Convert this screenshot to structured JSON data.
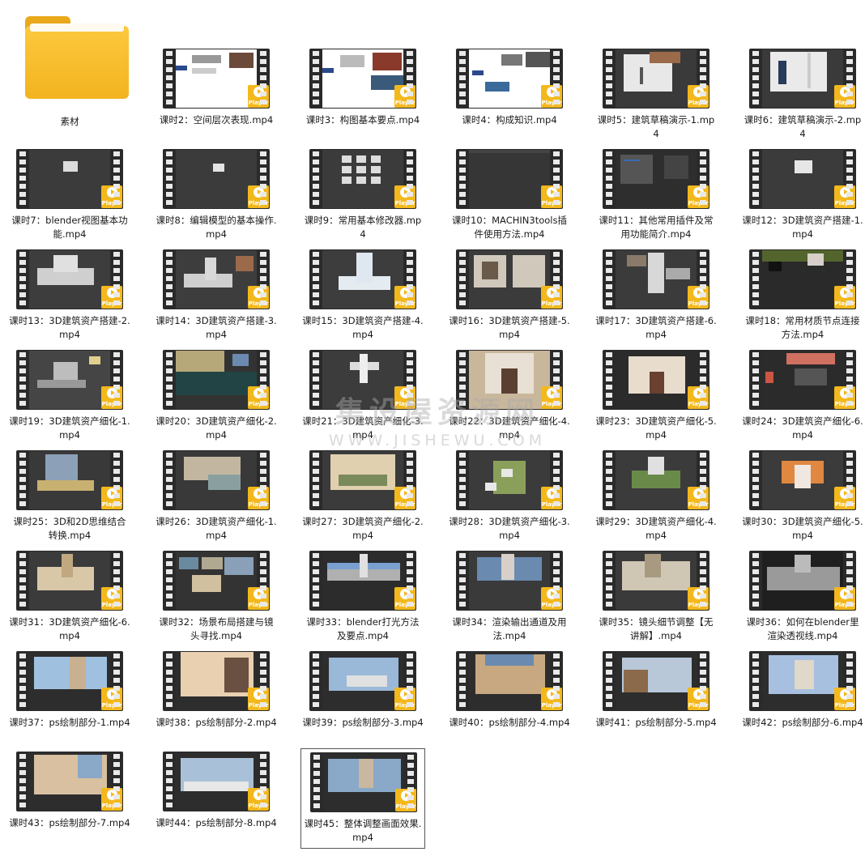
{
  "folder": {
    "label": "素材",
    "icon": "folder-icon"
  },
  "player_badge": "Player",
  "watermark": {
    "line1": "集设屋资源网",
    "line2": "WWW.JISHEWU.COM"
  },
  "videos": [
    {
      "label": "课时2：空间层次表现.mp4",
      "thumb": "mind"
    },
    {
      "label": "课时3：构图基本要点.mp4",
      "thumb": "mind2"
    },
    {
      "label": "课时4：构成知识.mp4",
      "thumb": "mind3"
    },
    {
      "label": "课时5：建筑草稿演示-1.mp4",
      "thumb": "sketch"
    },
    {
      "label": "课时6：建筑草稿演示-2.mp4",
      "thumb": "sketch2"
    },
    {
      "label": "课时7：blender视图基本功能.mp4",
      "thumb": "cube"
    },
    {
      "label": "课时8：编辑模型的基本操作.mp4",
      "thumb": "cube2"
    },
    {
      "label": "课时9：常用基本修改器.mp4",
      "thumb": "grid"
    },
    {
      "label": "课时10：MACHIN3tools插件使用方法.mp4",
      "thumb": "dark"
    },
    {
      "label": "课时11：其他常用插件及常用功能简介.mp4",
      "thumb": "ui"
    },
    {
      "label": "课时12：3D建筑资产搭建-1.mp4",
      "thumb": "cube3"
    },
    {
      "label": "课时13：3D建筑资产搭建-2.mp4",
      "thumb": "build"
    },
    {
      "label": "课时14：3D建筑资产搭建-3.mp4",
      "thumb": "build2"
    },
    {
      "label": "课时15：3D建筑资产搭建-4.mp4",
      "thumb": "tower"
    },
    {
      "label": "课时16：3D建筑资产搭建-5.mp4",
      "thumb": "refs"
    },
    {
      "label": "课时17：3D建筑资产搭建-6.mp4",
      "thumb": "refs2"
    },
    {
      "label": "课时18：常用材质节点连接方法.mp4",
      "thumb": "nodes"
    },
    {
      "label": "课时19：3D建筑资产细化-1.mp4",
      "thumb": "build3"
    },
    {
      "label": "课时20：3D建筑资产细化-2.mp4",
      "thumb": "scene"
    },
    {
      "label": "课时21：3D建筑资产细化-3.mp4",
      "thumb": "ship"
    },
    {
      "label": "课时22：3D建筑资产细化-4.mp4",
      "thumb": "arch"
    },
    {
      "label": "课时23：3D建筑资产细化-5.mp4",
      "thumb": "arch2"
    },
    {
      "label": "课时24：3D建筑资产细化-6.mp4",
      "thumb": "roof"
    },
    {
      "label": "课时25：3D和2D思维结合转换.mp4",
      "thumb": "city"
    },
    {
      "label": "课时26：3D建筑资产细化-1.mp4",
      "thumb": "city2"
    },
    {
      "label": "课时27：3D建筑资产细化-2.mp4",
      "thumb": "temple"
    },
    {
      "label": "课时28：3D建筑资产细化-3.mp4",
      "thumb": "green"
    },
    {
      "label": "课时29：3D建筑资产细化-4.mp4",
      "thumb": "green2"
    },
    {
      "label": "课时30：3D建筑资产细化-5.mp4",
      "thumb": "orange"
    },
    {
      "label": "课时31：3D建筑资产细化-6.mp4",
      "thumb": "city3"
    },
    {
      "label": "课时32：场景布局搭建与镜头寻找.mp4",
      "thumb": "collage"
    },
    {
      "label": "课时33：blender打光方法及要点.mp4",
      "thumb": "light"
    },
    {
      "label": "课时34：渲染输出通道及用法.mp4",
      "thumb": "render"
    },
    {
      "label": "课时35：镜头细节调整【无讲解】.mp4",
      "thumb": "city4"
    },
    {
      "label": "课时36：如何在blender里渲染透视线.mp4",
      "thumb": "lines"
    },
    {
      "label": "课时37：ps绘制部分-1.mp4",
      "thumb": "paint"
    },
    {
      "label": "课时38：ps绘制部分-2.mp4",
      "thumb": "paint2"
    },
    {
      "label": "课时39：ps绘制部分-3.mp4",
      "thumb": "paint3"
    },
    {
      "label": "课时40：ps绘制部分-4.mp4",
      "thumb": "paint4"
    },
    {
      "label": "课时41：ps绘制部分-5.mp4",
      "thumb": "paint5"
    },
    {
      "label": "课时42：ps绘制部分-6.mp4",
      "thumb": "paint6"
    },
    {
      "label": "课时43：ps绘制部分-7.mp4",
      "thumb": "paint7"
    },
    {
      "label": "课时44：ps绘制部分-8.mp4",
      "thumb": "paint8"
    },
    {
      "label": "课时45：整体调整画面效果.mp4",
      "thumb": "paint9",
      "selected": true
    }
  ],
  "colors": {
    "player": "#f3b81c",
    "folder": "#fcc93e",
    "film": "#2a2a2a"
  }
}
